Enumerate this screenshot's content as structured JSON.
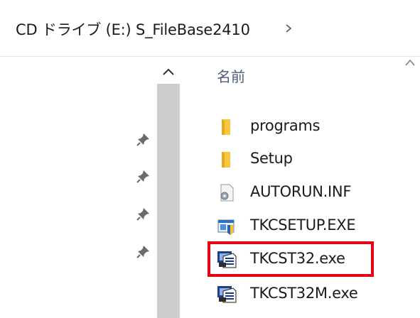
{
  "breadcrumb": {
    "path_text": "CD ドライブ (E:) S_FileBase2410",
    "chevron_icon": "chevron-right-icon"
  },
  "quick_access": {
    "pin_icon": "pin-icon",
    "pinned_count": 4
  },
  "scrollbar": {
    "up_icon": "chevron-up-icon"
  },
  "file_list": {
    "column_header": "名前",
    "sort_icon": "sort-ascending-caret-icon",
    "files": [
      {
        "name": "programs",
        "icon": "folder-icon"
      },
      {
        "name": "Setup",
        "icon": "folder-icon"
      },
      {
        "name": "AUTORUN.INF",
        "icon": "settings-file-icon"
      },
      {
        "name": "TKCSETUP.EXE",
        "icon": "installer-exe-icon"
      },
      {
        "name": "TKCST32.exe",
        "icon": "program-exe-icon"
      },
      {
        "name": "TKCST32M.exe",
        "icon": "program-exe-icon"
      }
    ],
    "highlighted_file": "TKCST32.exe"
  },
  "colors": {
    "highlight_border": "#e60012",
    "folder_yellow": "#f8c63f",
    "header_text": "#4c607a",
    "scrollbar_thumb": "#cdcdcd"
  }
}
